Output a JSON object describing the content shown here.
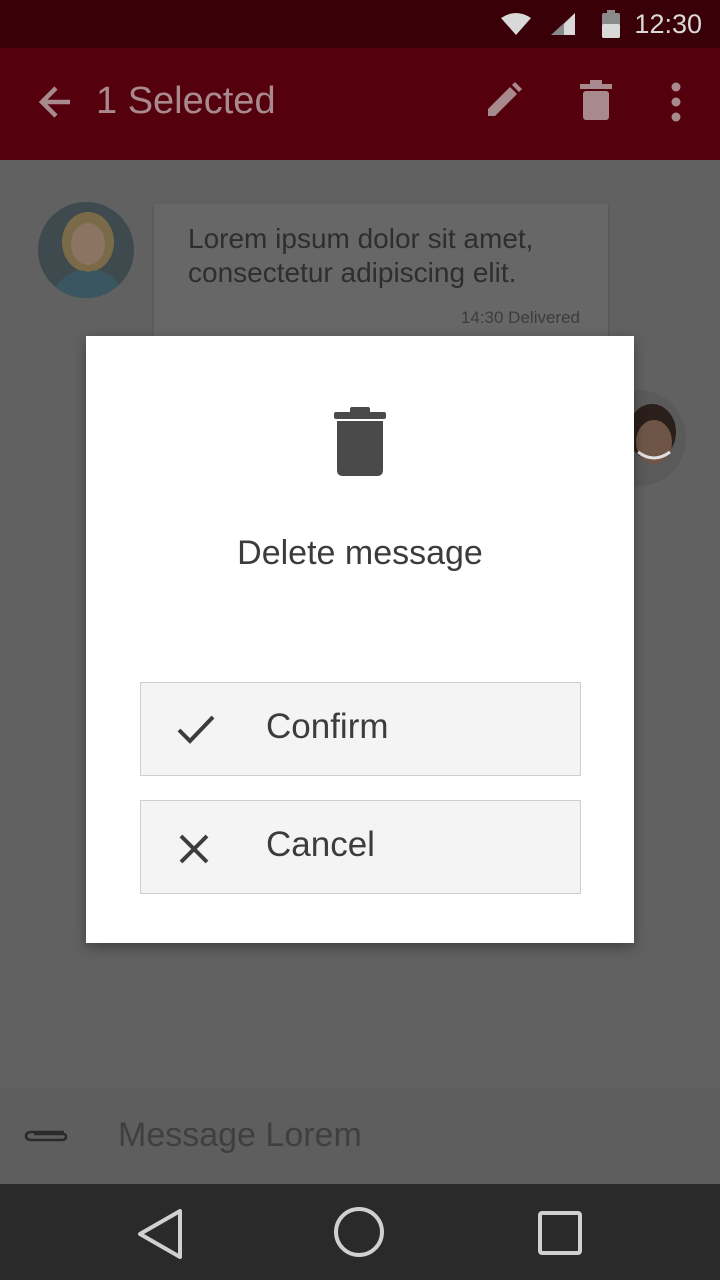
{
  "status_bar": {
    "time": "12:30",
    "icons": [
      "wifi-icon",
      "signal-icon",
      "battery-icon"
    ]
  },
  "app_bar": {
    "title": "1 Selected",
    "icons": [
      "back-arrow-icon",
      "edit-pencil-icon",
      "delete-trash-icon",
      "more-vert-icon"
    ]
  },
  "chat": {
    "message": {
      "text": "Lorem ipsum dolor sit amet, consectetur adipiscing elit.",
      "meta": "14:30 Delivered"
    }
  },
  "dialog": {
    "icon": "trash-icon",
    "title": "Delete message",
    "confirm_label": "Confirm",
    "cancel_label": "Cancel"
  },
  "composer": {
    "placeholder": "Message Lorem",
    "icon": "attach-paperclip-icon"
  },
  "nav_bar": {
    "icons": [
      "back-triangle-icon",
      "home-circle-icon",
      "recents-square-icon"
    ]
  },
  "colors": {
    "status_bar": "#3a0007",
    "app_bar": "#55000d",
    "scrim": "#616161",
    "dialog_bg": "#ffffff",
    "button_bg": "#f4f4f4"
  }
}
